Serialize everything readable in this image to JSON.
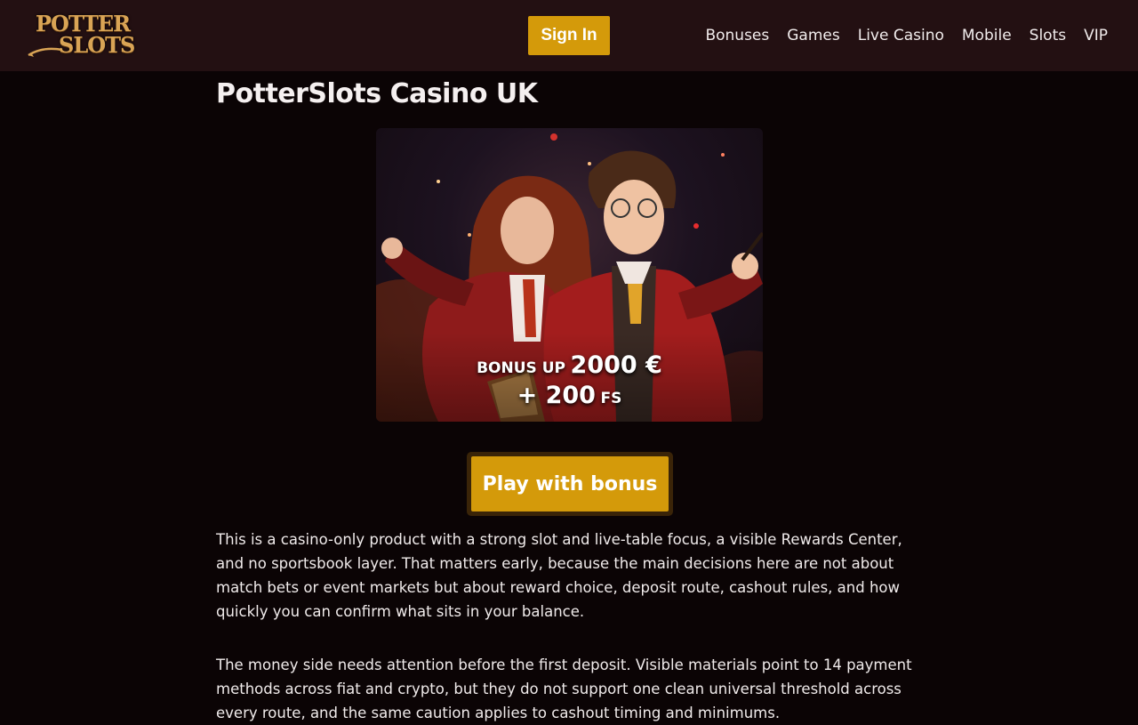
{
  "header": {
    "logo_line1": "POTTER",
    "logo_line2": "SLOTS",
    "signin_label": "Sign In",
    "nav": [
      "Bonuses",
      "Games",
      "Live Casino",
      "Mobile",
      "Slots",
      "VIP"
    ]
  },
  "main": {
    "title": "PotterSlots Casino UK",
    "hero": {
      "bonus_prefix": "BONUS UP",
      "bonus_amount": "2000 €",
      "bonus_plus": "+ 200",
      "bonus_fs": "FS"
    },
    "play_label": "Play with bonus",
    "paragraphs": [
      "This is a casino-only product with a strong slot and live-table focus, a visible Rewards Center, and no sportsbook layer. That matters early, because the main decisions here are not about match bets or event markets but about reward choice, deposit route, cashout rules, and how quickly you can confirm what sits in your balance.",
      "The money side needs attention before the first deposit. Visible materials point to 14 payment methods across fiat and crypto, but they do not support one clean universal threshold across every route, and the same caution applies to cashout timing and minimums."
    ]
  },
  "colors": {
    "header_bg": "#231012",
    "page_bg": "#0b0405",
    "accent": "#d49a0a",
    "logo_gold": "#d9a455"
  }
}
